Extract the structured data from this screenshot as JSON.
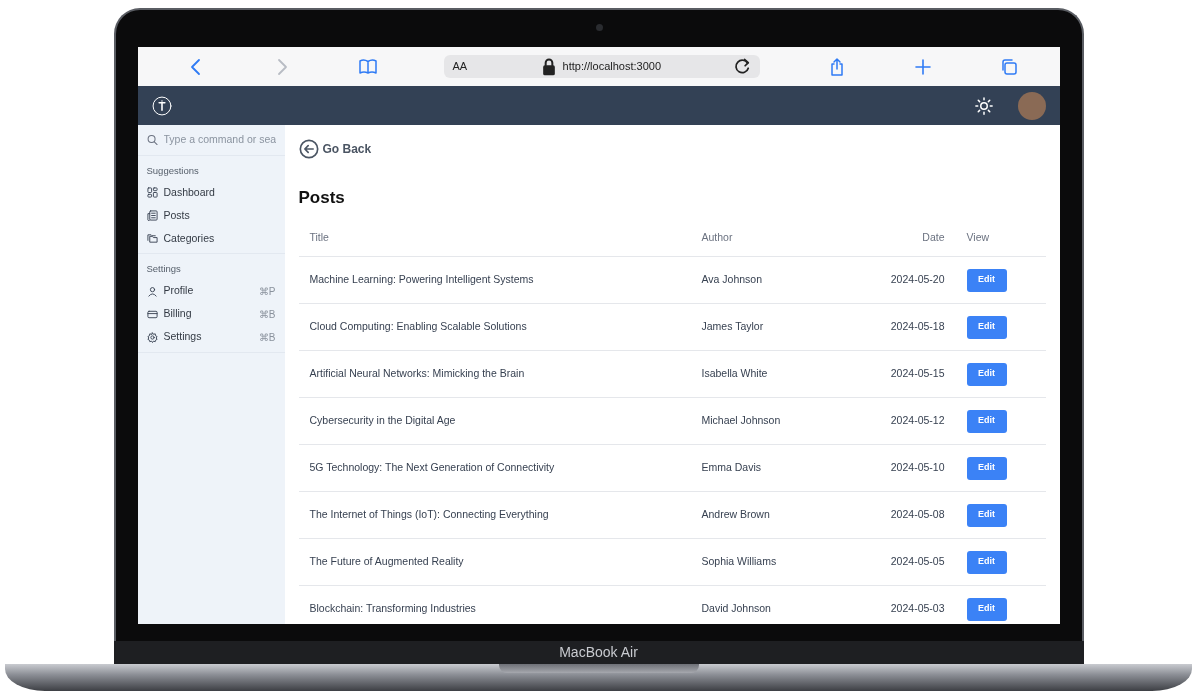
{
  "browser": {
    "reader_label": "AA",
    "url": "http://localhost:3000"
  },
  "sidebar": {
    "search": {
      "placeholder": "Type a command or sea"
    },
    "groups": [
      {
        "heading": "Suggestions",
        "items": [
          {
            "label": "Dashboard"
          },
          {
            "label": "Posts"
          },
          {
            "label": "Categories"
          }
        ]
      },
      {
        "heading": "Settings",
        "items": [
          {
            "label": "Profile",
            "shortcut": "⌘P"
          },
          {
            "label": "Billing",
            "shortcut": "⌘B"
          },
          {
            "label": "Settings",
            "shortcut": "⌘B"
          }
        ]
      }
    ]
  },
  "back_link": "Go Back",
  "page_title": "Posts",
  "table": {
    "columns": [
      "Title",
      "Author",
      "Date",
      "View"
    ],
    "rows": [
      {
        "title": "Machine Learning: Powering Intelligent Systems",
        "author": "Ava Johnson",
        "date": "2024-05-20",
        "action": "Edit"
      },
      {
        "title": "Cloud Computing: Enabling Scalable Solutions",
        "author": "James Taylor",
        "date": "2024-05-18",
        "action": "Edit"
      },
      {
        "title": "Artificial Neural Networks: Mimicking the Brain",
        "author": "Isabella White",
        "date": "2024-05-15",
        "action": "Edit"
      },
      {
        "title": "Cybersecurity in the Digital Age",
        "author": "Michael Johnson",
        "date": "2024-05-12",
        "action": "Edit"
      },
      {
        "title": "5G Technology: The Next Generation of Connectivity",
        "author": "Emma Davis",
        "date": "2024-05-10",
        "action": "Edit"
      },
      {
        "title": "The Internet of Things (IoT): Connecting Everything",
        "author": "Andrew Brown",
        "date": "2024-05-08",
        "action": "Edit"
      },
      {
        "title": "The Future of Augmented Reality",
        "author": "Sophia Williams",
        "date": "2024-05-05",
        "action": "Edit"
      },
      {
        "title": "Blockchain: Transforming Industries",
        "author": "David Johnson",
        "date": "2024-05-03",
        "action": "Edit"
      }
    ]
  },
  "device_label": "MacBook Air"
}
